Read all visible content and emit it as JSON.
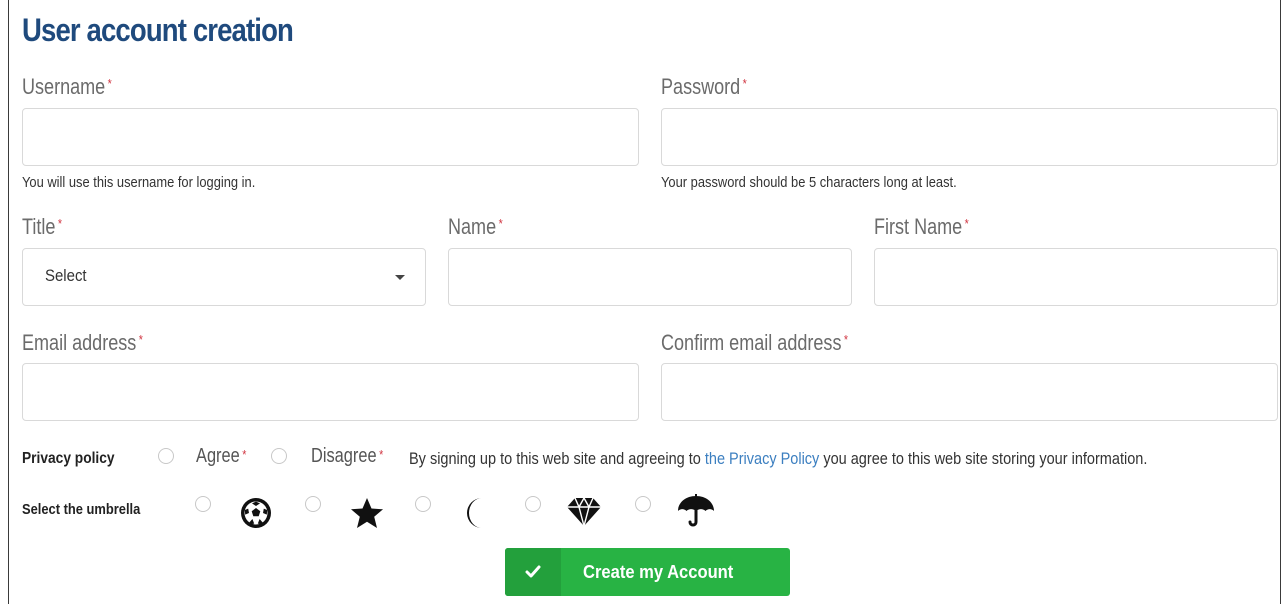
{
  "page": {
    "title": "User account creation"
  },
  "form": {
    "username": {
      "label": "Username",
      "required_mark": "*",
      "hint": "You will use this username for logging in.",
      "value": ""
    },
    "password": {
      "label": "Password",
      "required_mark": "*",
      "hint": "Your password should be 5 characters long at least.",
      "value": ""
    },
    "title": {
      "label": "Title",
      "required_mark": "*",
      "selected": "Select"
    },
    "name": {
      "label": "Name",
      "required_mark": "*",
      "value": ""
    },
    "first_name": {
      "label": "First Name",
      "required_mark": "*",
      "value": ""
    },
    "email": {
      "label": "Email address",
      "required_mark": "*",
      "value": ""
    },
    "confirm_email": {
      "label": "Confirm email address",
      "required_mark": "*",
      "value": ""
    },
    "privacy": {
      "label": "Privacy policy",
      "agree": "Agree",
      "disagree": "Disagree",
      "required_mark": "*",
      "text_before": "By signing up to this web site and agreeing to ",
      "link_text": "the Privacy Policy",
      "text_after": " you agree to this web site storing your information."
    },
    "umbrella": {
      "label": "Select the umbrella",
      "options": [
        "soccer-ball-icon",
        "star-icon",
        "moon-icon",
        "diamond-icon",
        "umbrella-icon"
      ]
    },
    "submit_label": "Create my Account"
  },
  "colors": {
    "heading": "#1f4a7d",
    "required": "#d0333f",
    "link": "#3c7fc0",
    "button": "#28b344"
  }
}
